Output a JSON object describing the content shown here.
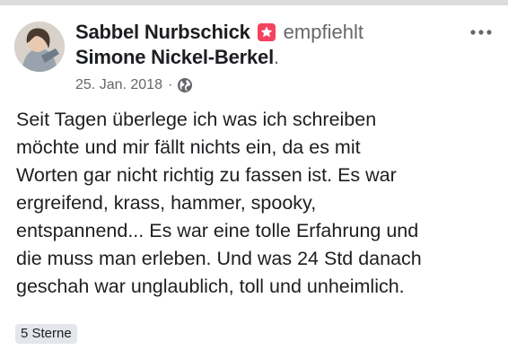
{
  "post": {
    "author": "Sabbel Nurbschick",
    "action": "empfiehlt",
    "target": "Simone Nickel-Berkel",
    "target_suffix": ".",
    "date": "25. Jan. 2018",
    "separator": "·",
    "privacy_icon": "globe-icon",
    "recommend_icon": "recommendation-icon",
    "more_icon": "more-options-icon",
    "text_lines": [
      "Seit Tagen überlege ich was ich schreiben",
      "möchte und mir fällt nichts ein, da es mit",
      "Worten gar nicht richtig zu fassen ist. Es war",
      "ergreifend, krass, hammer, spooky,",
      "entspannend... Es war eine tolle Erfahrung und",
      "die muss man erleben. Und was 24 Std danach",
      "geschah war unglaublich, toll und unheimlich."
    ],
    "rating": "5 Sterne"
  },
  "colors": {
    "recommend": "#f3425f",
    "secondary_text": "#65676b",
    "primary_text": "#1c1e21",
    "badge_bg": "#e4e6eb"
  }
}
